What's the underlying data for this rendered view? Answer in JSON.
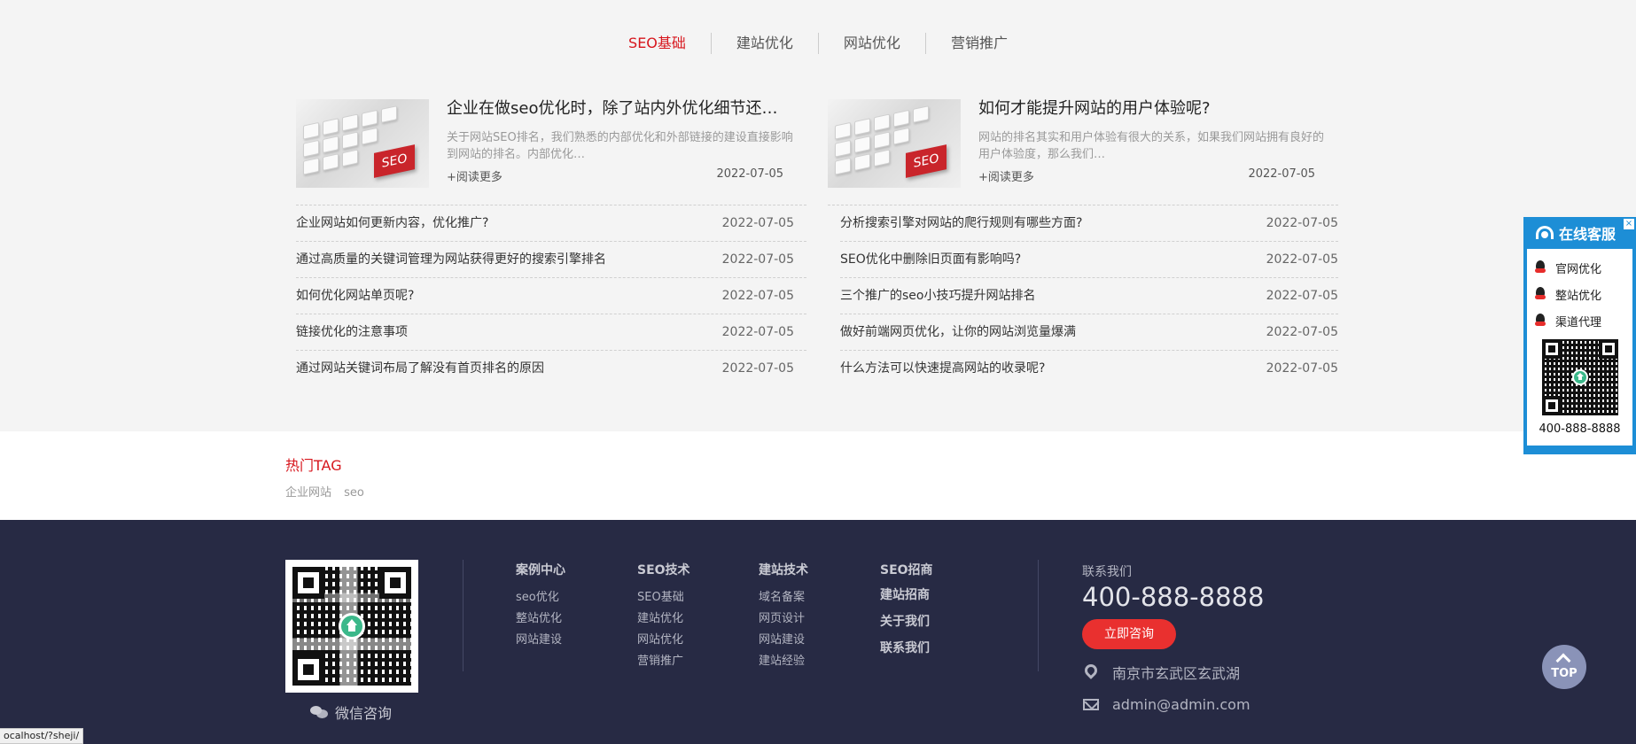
{
  "tabs": [
    {
      "label": "SEO基础",
      "active": true
    },
    {
      "label": "建站优化",
      "active": false
    },
    {
      "label": "网站优化",
      "active": false
    },
    {
      "label": "营销推广",
      "active": false
    }
  ],
  "left_column": {
    "feature": {
      "thumb_text": "SEO",
      "title": "企业在做seo优化时，除了站内外优化细节还…",
      "desc": "关于网站SEO排名，我们熟悉的内部优化和外部链接的建设直接影响到网站的排名。内部优化…",
      "more": "+阅读更多",
      "date": "2022-07-05"
    },
    "items": [
      {
        "title": "企业网站如何更新内容，优化推广?",
        "date": "2022-07-05"
      },
      {
        "title": "通过高质量的关键词管理为网站获得更好的搜索引擎排名",
        "date": "2022-07-05"
      },
      {
        "title": "如何优化网站单页呢?",
        "date": "2022-07-05"
      },
      {
        "title": "链接优化的注意事项",
        "date": "2022-07-05"
      },
      {
        "title": "通过网站关键词布局了解没有首页排名的原因",
        "date": "2022-07-05"
      }
    ]
  },
  "right_column": {
    "feature": {
      "thumb_text": "SEO",
      "title": "如何才能提升网站的用户体验呢?",
      "desc": "网站的排名其实和用户体验有很大的关系，如果我们网站拥有良好的用户体验度，那么我们…",
      "more": "+阅读更多",
      "date": "2022-07-05"
    },
    "items": [
      {
        "title": "分析搜索引擎对网站的爬行规则有哪些方面?",
        "date": "2022-07-05"
      },
      {
        "title": "SEO优化中删除旧页面有影响吗?",
        "date": "2022-07-05"
      },
      {
        "title": "三个推广的seo小技巧提升网站排名",
        "date": "2022-07-05"
      },
      {
        "title": "做好前端网页优化，让你的网站浏览量爆满",
        "date": "2022-07-05"
      },
      {
        "title": "什么方法可以快速提高网站的收录呢?",
        "date": "2022-07-05"
      }
    ]
  },
  "tags": {
    "title": "热门TAG",
    "items": [
      "企业网站",
      "seo"
    ]
  },
  "footer": {
    "wechat_label": "微信咨询",
    "columns": [
      {
        "title": "案例中心",
        "links": [
          "seo优化",
          "整站优化",
          "网站建设"
        ]
      },
      {
        "title": "SEO技术",
        "links": [
          "SEO基础",
          "建站优化",
          "网站优化",
          "营销推广"
        ]
      },
      {
        "title": "建站技术",
        "links": [
          "域名备案",
          "网页设计",
          "网站建设",
          "建站经验"
        ]
      },
      {
        "title": "SEO招商",
        "links": [
          "建站招商",
          "关于我们",
          "联系我们"
        ]
      }
    ],
    "contact": {
      "label": "联系我们",
      "phone": "400-888-8888",
      "button": "立即咨询",
      "address": "南京市玄武区玄武湖",
      "email": "admin@admin.com"
    },
    "top_label": "TOP"
  },
  "status_bar": "ocalhost/?sheji/",
  "service": {
    "title": "在线客服",
    "close": "×",
    "items": [
      "官网优化",
      "整站优化",
      "渠道代理"
    ],
    "phone": "400-888-8888"
  },
  "colors": {
    "accent_red": "#d7161d",
    "footer_bg": "#272a44",
    "service_blue": "#1d8ed6",
    "consult_red": "#e9302f"
  }
}
